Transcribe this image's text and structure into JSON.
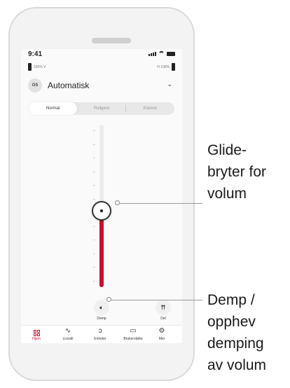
{
  "status_bar": {
    "time": "9:41"
  },
  "battery": {
    "left_label": "100%  V",
    "right_label": "H  100%"
  },
  "program": {
    "icon_text": "OS",
    "name": "Automatisk",
    "chevron": "⌄"
  },
  "sound_modes": [
    {
      "label": "Normal",
      "active": true
    },
    {
      "label": "Roligere",
      "active": false
    },
    {
      "label": "Klarere",
      "active": false
    }
  ],
  "volume": {
    "level_fraction": 0.47
  },
  "actions": {
    "mute": {
      "label": "Demp",
      "icon": "speaker-icon",
      "glyph": "🔈︎"
    },
    "share": {
      "label": "Del",
      "icon": "share-icon",
      "glyph": "⇈"
    }
  },
  "nav": [
    {
      "label": "Hjem",
      "icon": "home-grid-icon",
      "active": true
    },
    {
      "label": "Livsstil",
      "icon": "activity-icon",
      "glyph": "∿"
    },
    {
      "label": "Enheter",
      "icon": "hearing-aid-icon",
      "glyph": "ↄ"
    },
    {
      "label": "Brukerstøtte",
      "icon": "chat-icon",
      "glyph": "▭"
    },
    {
      "label": "Mer",
      "icon": "gear-icon",
      "glyph": "⚙"
    }
  ],
  "annotations": {
    "slider": [
      "Glide-",
      "bryter for",
      "volum"
    ],
    "mute": [
      "Demp /",
      "opphev",
      "demping",
      "av volum"
    ]
  },
  "colors": {
    "accent": "#c8102e",
    "phone_body": "#f3f3f3",
    "screen": "#fafafa"
  }
}
